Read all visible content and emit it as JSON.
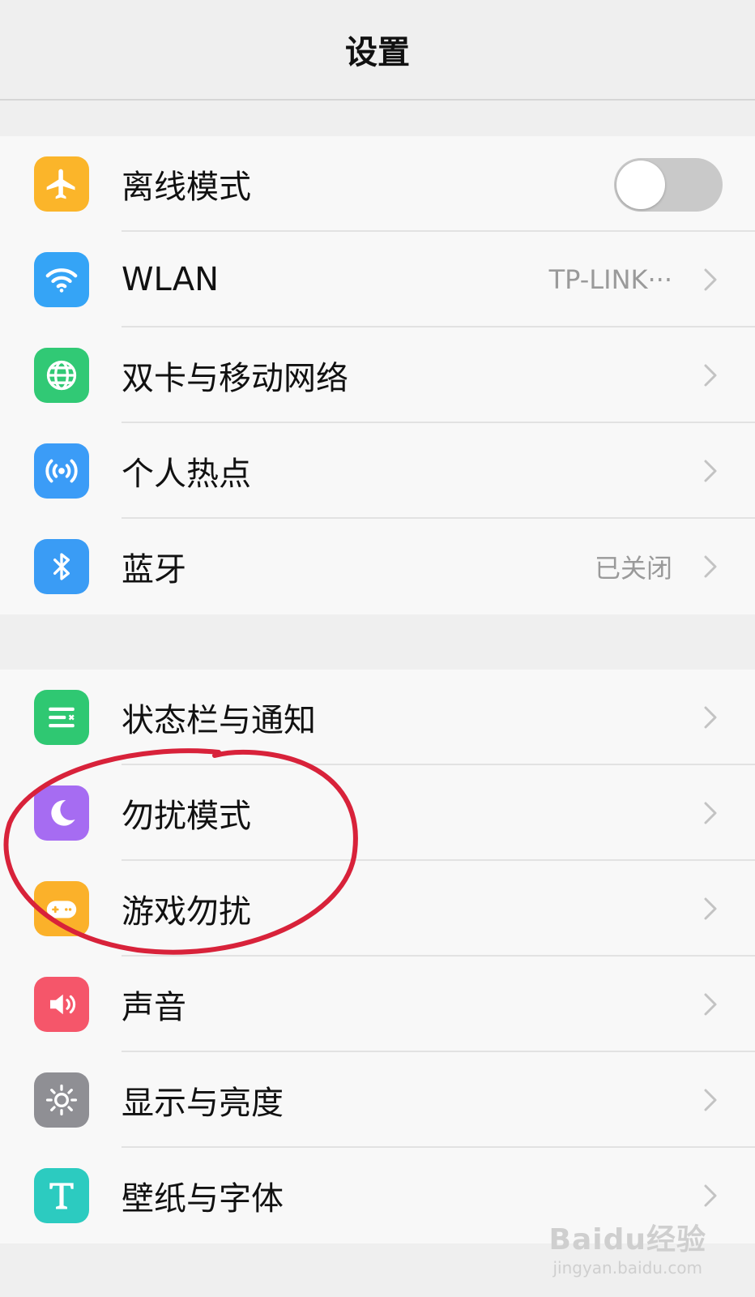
{
  "header": {
    "title": "设置"
  },
  "groups": [
    {
      "items": [
        {
          "label": "离线模式",
          "icon": "airplane-icon",
          "color": "#fbb52a",
          "toggle": false
        },
        {
          "label": "WLAN",
          "icon": "wifi-icon",
          "color": "#35a4f6",
          "value": "TP-LINK···"
        },
        {
          "label": "双卡与移动网络",
          "icon": "globe-icon",
          "color": "#31c975"
        },
        {
          "label": "个人热点",
          "icon": "hotspot-icon",
          "color": "#3b9cf7"
        },
        {
          "label": "蓝牙",
          "icon": "bluetooth-icon",
          "color": "#3a9cf5",
          "value": "已关闭"
        }
      ]
    },
    {
      "items": [
        {
          "label": "状态栏与通知",
          "icon": "statusbar-icon",
          "color": "#2fc872"
        },
        {
          "label": "勿扰模式",
          "icon": "moon-icon",
          "color": "#a66cf2"
        },
        {
          "label": "游戏勿扰",
          "icon": "gamepad-icon",
          "color": "#fbb12a"
        },
        {
          "label": "声音",
          "icon": "speaker-icon",
          "color": "#f5566a"
        },
        {
          "label": "显示与亮度",
          "icon": "sun-icon",
          "color": "#8f8f94"
        },
        {
          "label": "壁纸与字体",
          "icon": "text-t-icon",
          "color": "#2ccbc0"
        }
      ]
    }
  ],
  "watermark": {
    "main": "Baidu经验",
    "sub": "jingyan.baidu.com"
  }
}
